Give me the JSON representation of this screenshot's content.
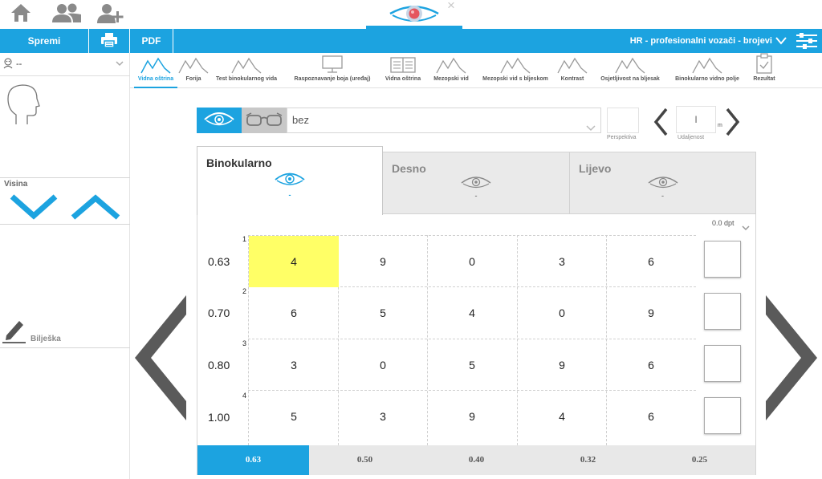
{
  "header": {
    "icons": [
      "home-icon",
      "patients-icon",
      "add-patient-icon"
    ],
    "close_glyph": "×"
  },
  "toolbar": {
    "save_label": "Spremi",
    "pdf_label": "PDF",
    "test_title": "HR - profesionalni vozači - brojevi"
  },
  "sidebar": {
    "person_value": "--",
    "height_label": "Visina",
    "note_label": "Bilješka"
  },
  "tabs": [
    {
      "label": "Vidna oštrina",
      "active": true
    },
    {
      "label": "Forija",
      "active": false
    },
    {
      "label": "Test binokularnog vida",
      "active": false
    },
    {
      "label": "Raspoznavanje boja (uređaj)",
      "active": false
    },
    {
      "label": "Vidna oštrina",
      "active": false
    },
    {
      "label": "Mezopski vid",
      "active": false
    },
    {
      "label": "Mezopski vid s bljeskom",
      "active": false
    },
    {
      "label": "Kontrast",
      "active": false
    },
    {
      "label": "Osjetljivost na bljesak",
      "active": false
    },
    {
      "label": "Binokularno vidno polje",
      "active": false
    },
    {
      "label": "Rezultat",
      "active": false
    }
  ],
  "controls": {
    "correction_value": "bez",
    "perspective_label": "Perspektiva",
    "distance_value": "I",
    "distance_unit": "m",
    "distance_label": "Udaljenost"
  },
  "eye_tabs": [
    {
      "label": "Binokularno",
      "value": "-",
      "active": true
    },
    {
      "label": "Desno",
      "value": "-",
      "active": false
    },
    {
      "label": "Lijevo",
      "value": "-",
      "active": false
    }
  ],
  "dpt_value": "0.0 dpt",
  "rows": [
    {
      "index": "1",
      "acuity": "0.63",
      "cells": [
        "4",
        "9",
        "0",
        "3",
        "6"
      ],
      "highlight": 0
    },
    {
      "index": "2",
      "acuity": "0.70",
      "cells": [
        "6",
        "5",
        "4",
        "0",
        "9"
      ],
      "highlight": -1
    },
    {
      "index": "3",
      "acuity": "0.80",
      "cells": [
        "3",
        "0",
        "5",
        "9",
        "6"
      ],
      "highlight": -1
    },
    {
      "index": "4",
      "acuity": "1.00",
      "cells": [
        "5",
        "3",
        "9",
        "4",
        "6"
      ],
      "highlight": -1
    }
  ],
  "acuity_levels": [
    {
      "label": "0.63",
      "active": true
    },
    {
      "label": "0.50",
      "active": false
    },
    {
      "label": "0.40",
      "active": false
    },
    {
      "label": "0.32",
      "active": false
    },
    {
      "label": "0.25",
      "active": false
    }
  ],
  "colors": {
    "accent": "#1ca3e0",
    "highlight": "#ffff66",
    "nav_arrow": "#5a5a5a"
  }
}
